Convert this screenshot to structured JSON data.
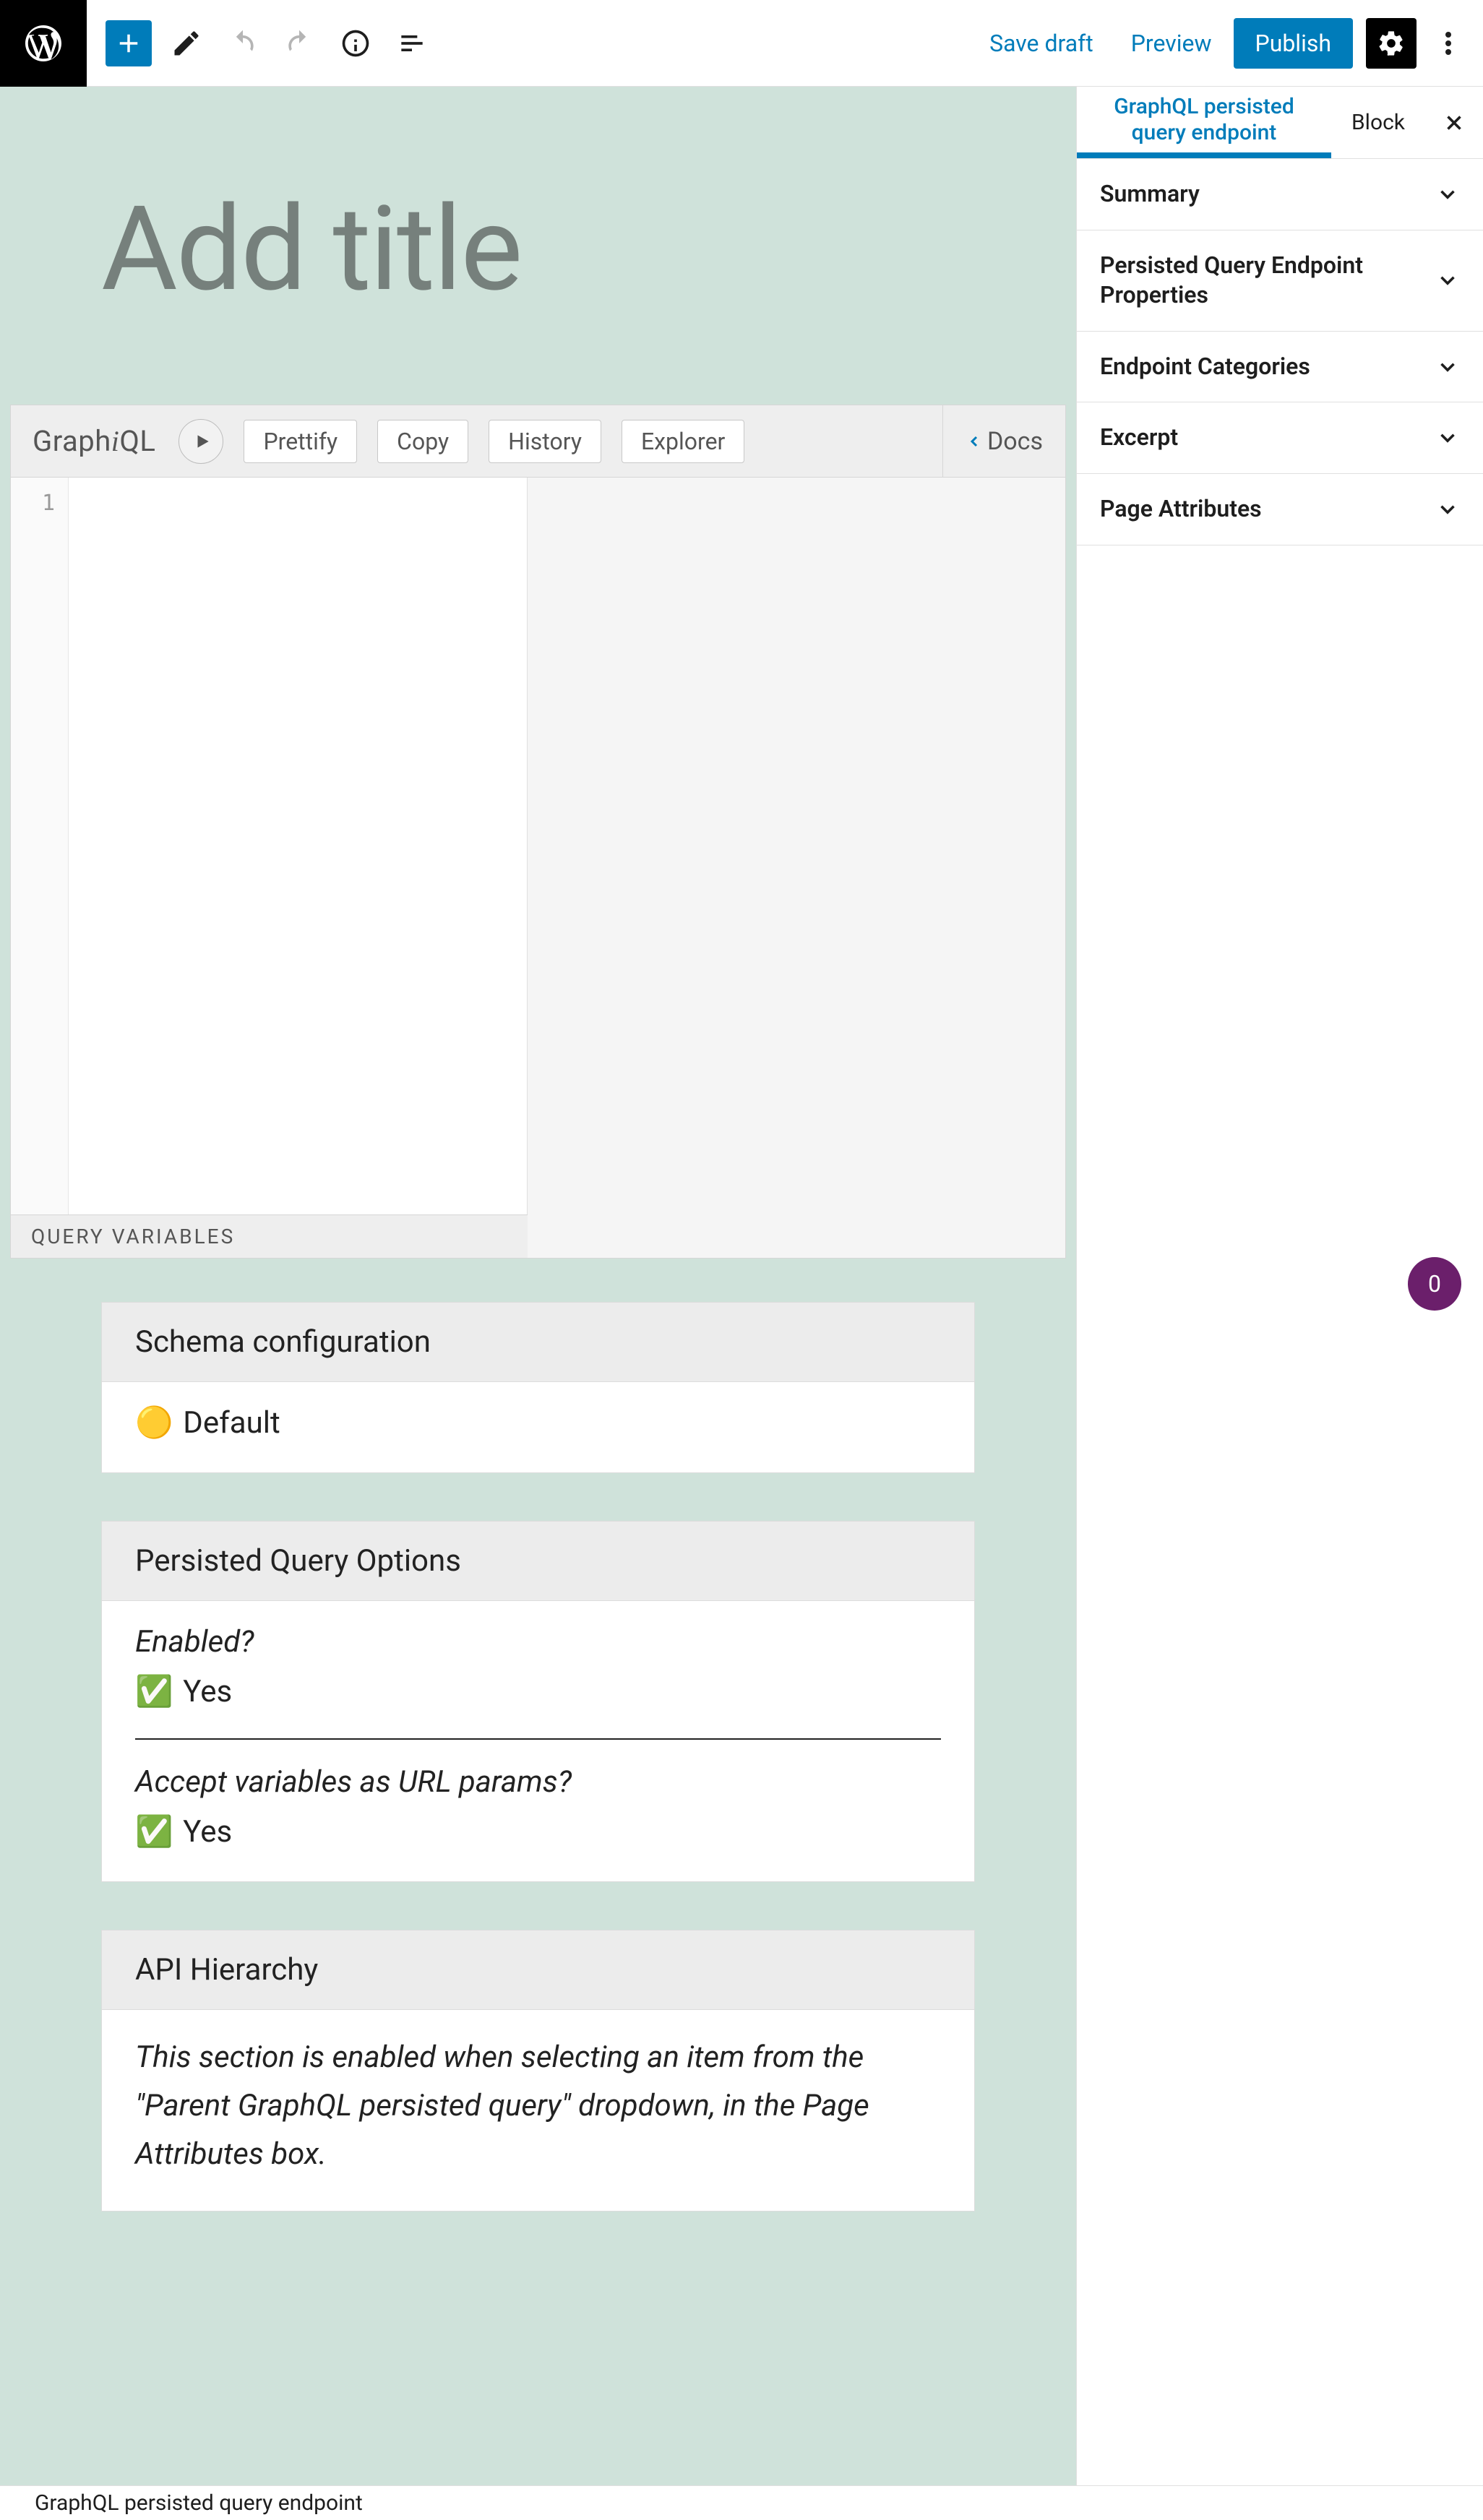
{
  "toolbar": {
    "save_draft": "Save draft",
    "preview": "Preview",
    "publish": "Publish"
  },
  "title_placeholder": "Add title",
  "graphiql": {
    "play_tooltip": "Execute",
    "prettify": "Prettify",
    "copy": "Copy",
    "history": "History",
    "explorer": "Explorer",
    "docs": "Docs",
    "gutter_line": "1",
    "vars_label": "QUERY VARIABLES"
  },
  "cards": {
    "schema": {
      "title": "Schema configuration",
      "value_icon": "🟡",
      "value": "Default"
    },
    "options": {
      "title": "Persisted Query Options",
      "q1": "Enabled?",
      "a1_icon": "✅",
      "a1": "Yes",
      "q2": "Accept variables as URL params?",
      "a2_icon": "✅",
      "a2": "Yes"
    },
    "hierarchy": {
      "title": "API Hierarchy",
      "body": "This section is enabled when selecting an item from the \"Parent GraphQL persisted query\" dropdown, in the Page Attributes box."
    }
  },
  "sidebar": {
    "tab_active": "GraphQL persisted query endpoint",
    "tab_block": "Block",
    "panels": [
      "Summary",
      "Persisted Query Endpoint Properties",
      "Endpoint Categories",
      "Excerpt",
      "Page Attributes"
    ]
  },
  "badge": "0",
  "footer": "GraphQL persisted query endpoint"
}
